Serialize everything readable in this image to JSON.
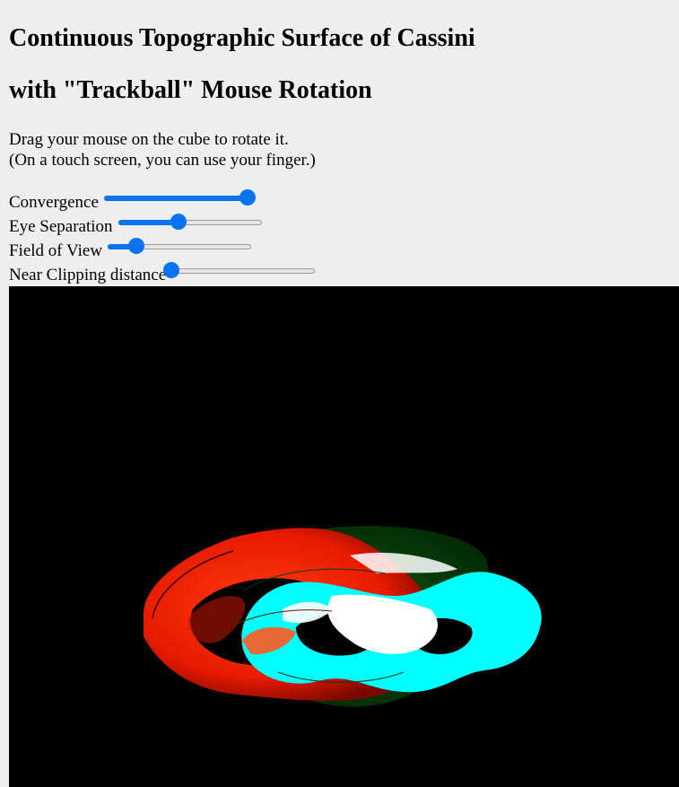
{
  "title_line1": "Continuous Topographic Surface of Cassini",
  "title_line2": "with \"Trackball\" Mouse Rotation",
  "instructions": {
    "line1": "Drag your mouse on the cube to rotate it.",
    "line2": "(On a touch screen, you can use your finger.)"
  },
  "controls": {
    "convergence": {
      "label": "Convergence",
      "value": 1.0
    },
    "eye_separation": {
      "label": "Eye Separation",
      "value": 0.42
    },
    "field_of_view": {
      "label": "Field of View",
      "value": 0.2
    },
    "near_clipping": {
      "label": "Near Clipping distance",
      "value": 0.0
    }
  },
  "colors": {
    "page_bg": "#eeeeee",
    "slider_accent": "#0a74f0",
    "canvas_bg": "#000000",
    "left_eye": "#ff2a00",
    "right_eye": "#00ffff"
  }
}
